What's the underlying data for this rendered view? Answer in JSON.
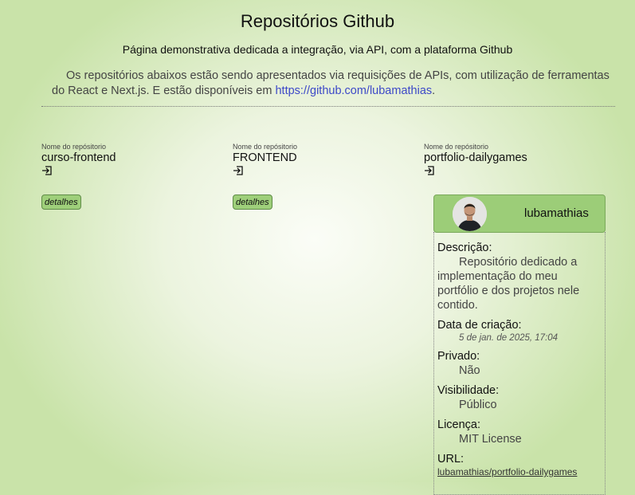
{
  "page": {
    "title": "Repositórios Github",
    "subtitle": "Página demonstrativa dedicada a integração, via API, com a plataforma Github",
    "intro_text": "Os repositórios abaixos estão sendo apresentados via requisições de APIs, com utilização de ferramentas do React e Next.js. E estão disponíveis em ",
    "intro_link": "https://github.com/lubamathias",
    "intro_end": "."
  },
  "repos": [
    {
      "caption": "Nome do repósitorio",
      "name": "curso-frontend",
      "details_label": "detalhes",
      "icon": "enter-icon"
    },
    {
      "caption": "Nome do repósitorio",
      "name": "FRONTEND",
      "details_label": "detalhes",
      "icon": "enter-icon"
    },
    {
      "caption": "Nome do repósitorio",
      "name": "portfolio-dailygames",
      "icon": "enter-icon"
    }
  ],
  "detail_card": {
    "login": "lubamathias",
    "avatar_icon": "user-avatar",
    "description_label": "Descrição:",
    "description": "Repositório dedicado a implementação do meu portfólio e dos projetos nele contido.",
    "created_label": "Data de criação:",
    "created_value": "5 de jan. de 2025, 17:04",
    "private_label": "Privado:",
    "private_value": "Não",
    "visibility_label": "Visibilidade:",
    "visibility_value": "Público",
    "license_label": "Licença:",
    "license_value": "MIT License",
    "url_label": "URL:",
    "url_value": "lubamathias/portfolio-dailygames"
  },
  "colors": {
    "accent": "#9ccd78",
    "link": "#3c48c8",
    "background_edge": "#c9e3a9"
  }
}
